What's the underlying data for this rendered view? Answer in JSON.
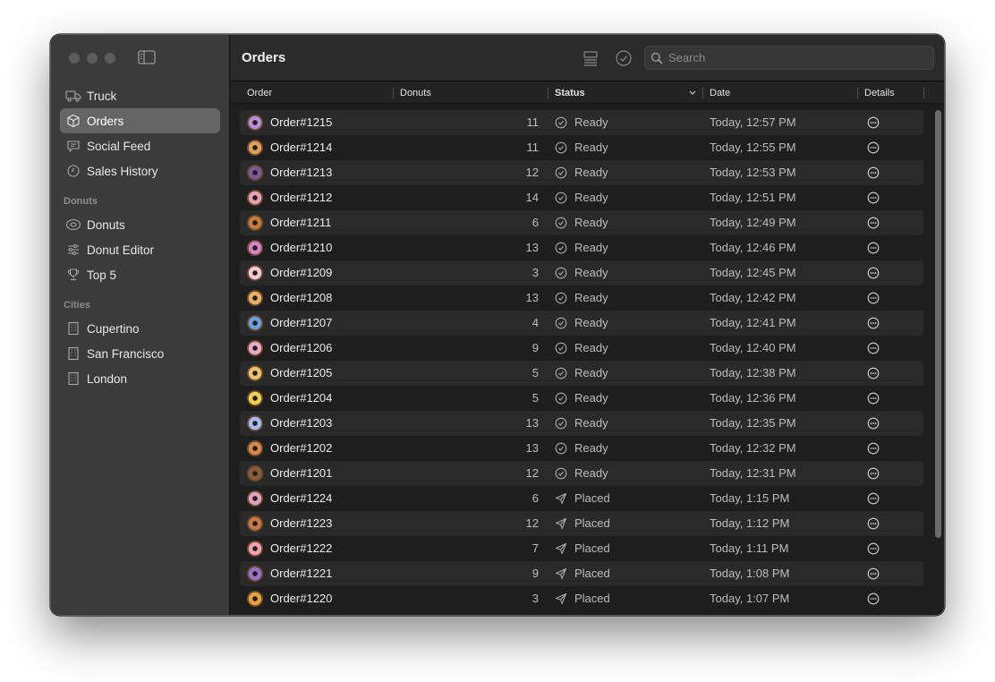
{
  "sidebar": {
    "items": [
      {
        "label": "Truck",
        "icon": "truck-icon"
      },
      {
        "label": "Orders",
        "icon": "box-icon",
        "active": true
      },
      {
        "label": "Social Feed",
        "icon": "chat-bubble-icon"
      },
      {
        "label": "Sales History",
        "icon": "clock-icon"
      }
    ],
    "sections": [
      {
        "title": "Donuts",
        "items": [
          {
            "label": "Donuts",
            "icon": "donut-icon"
          },
          {
            "label": "Donut Editor",
            "icon": "sliders-icon"
          },
          {
            "label": "Top 5",
            "icon": "trophy-icon"
          }
        ]
      },
      {
        "title": "Cities",
        "items": [
          {
            "label": "Cupertino",
            "icon": "building-icon"
          },
          {
            "label": "San Francisco",
            "icon": "building-icon"
          },
          {
            "label": "London",
            "icon": "building-icon"
          }
        ]
      }
    ]
  },
  "toolbar": {
    "title": "Orders",
    "search_placeholder": "Search"
  },
  "table": {
    "columns": {
      "order": "Order",
      "donuts": "Donuts",
      "status": "Status",
      "date": "Date",
      "details": "Details"
    },
    "rows": [
      {
        "order": "Order#1215",
        "donuts": "11",
        "status": "Ready",
        "date": "Today, 12:57 PM",
        "color": "#b78cd8"
      },
      {
        "order": "Order#1214",
        "donuts": "11",
        "status": "Ready",
        "date": "Today, 12:55 PM",
        "color": "#e0a05a"
      },
      {
        "order": "Order#1213",
        "donuts": "12",
        "status": "Ready",
        "date": "Today, 12:53 PM",
        "color": "#7a5a9c"
      },
      {
        "order": "Order#1212",
        "donuts": "14",
        "status": "Ready",
        "date": "Today, 12:51 PM",
        "color": "#e8a0b8"
      },
      {
        "order": "Order#1211",
        "donuts": "6",
        "status": "Ready",
        "date": "Today, 12:49 PM",
        "color": "#c8793c"
      },
      {
        "order": "Order#1210",
        "donuts": "13",
        "status": "Ready",
        "date": "Today, 12:46 PM",
        "color": "#d880c8"
      },
      {
        "order": "Order#1209",
        "donuts": "3",
        "status": "Ready",
        "date": "Today, 12:45 PM",
        "color": "#f4c8d4"
      },
      {
        "order": "Order#1208",
        "donuts": "13",
        "status": "Ready",
        "date": "Today, 12:42 PM",
        "color": "#e8b060"
      },
      {
        "order": "Order#1207",
        "donuts": "4",
        "status": "Ready",
        "date": "Today, 12:41 PM",
        "color": "#6aa0e0"
      },
      {
        "order": "Order#1206",
        "donuts": "9",
        "status": "Ready",
        "date": "Today, 12:40 PM",
        "color": "#f0a8c8"
      },
      {
        "order": "Order#1205",
        "donuts": "5",
        "status": "Ready",
        "date": "Today, 12:38 PM",
        "color": "#e8c070"
      },
      {
        "order": "Order#1204",
        "donuts": "5",
        "status": "Ready",
        "date": "Today, 12:36 PM",
        "color": "#f0d050"
      },
      {
        "order": "Order#1203",
        "donuts": "13",
        "status": "Ready",
        "date": "Today, 12:35 PM",
        "color": "#a8b8f0"
      },
      {
        "order": "Order#1202",
        "donuts": "13",
        "status": "Ready",
        "date": "Today, 12:32 PM",
        "color": "#d8884c"
      },
      {
        "order": "Order#1201",
        "donuts": "12",
        "status": "Ready",
        "date": "Today, 12:31 PM",
        "color": "#8a5a3c"
      },
      {
        "order": "Order#1224",
        "donuts": "6",
        "status": "Placed",
        "date": "Today, 1:15 PM",
        "color": "#e0a0c0"
      },
      {
        "order": "Order#1223",
        "donuts": "12",
        "status": "Placed",
        "date": "Today, 1:12 PM",
        "color": "#c87848"
      },
      {
        "order": "Order#1222",
        "donuts": "7",
        "status": "Placed",
        "date": "Today, 1:11 PM",
        "color": "#f0a0b0"
      },
      {
        "order": "Order#1221",
        "donuts": "9",
        "status": "Placed",
        "date": "Today, 1:08 PM",
        "color": "#9a70c8"
      },
      {
        "order": "Order#1220",
        "donuts": "3",
        "status": "Placed",
        "date": "Today, 1:07 PM",
        "color": "#e8a040"
      }
    ]
  }
}
